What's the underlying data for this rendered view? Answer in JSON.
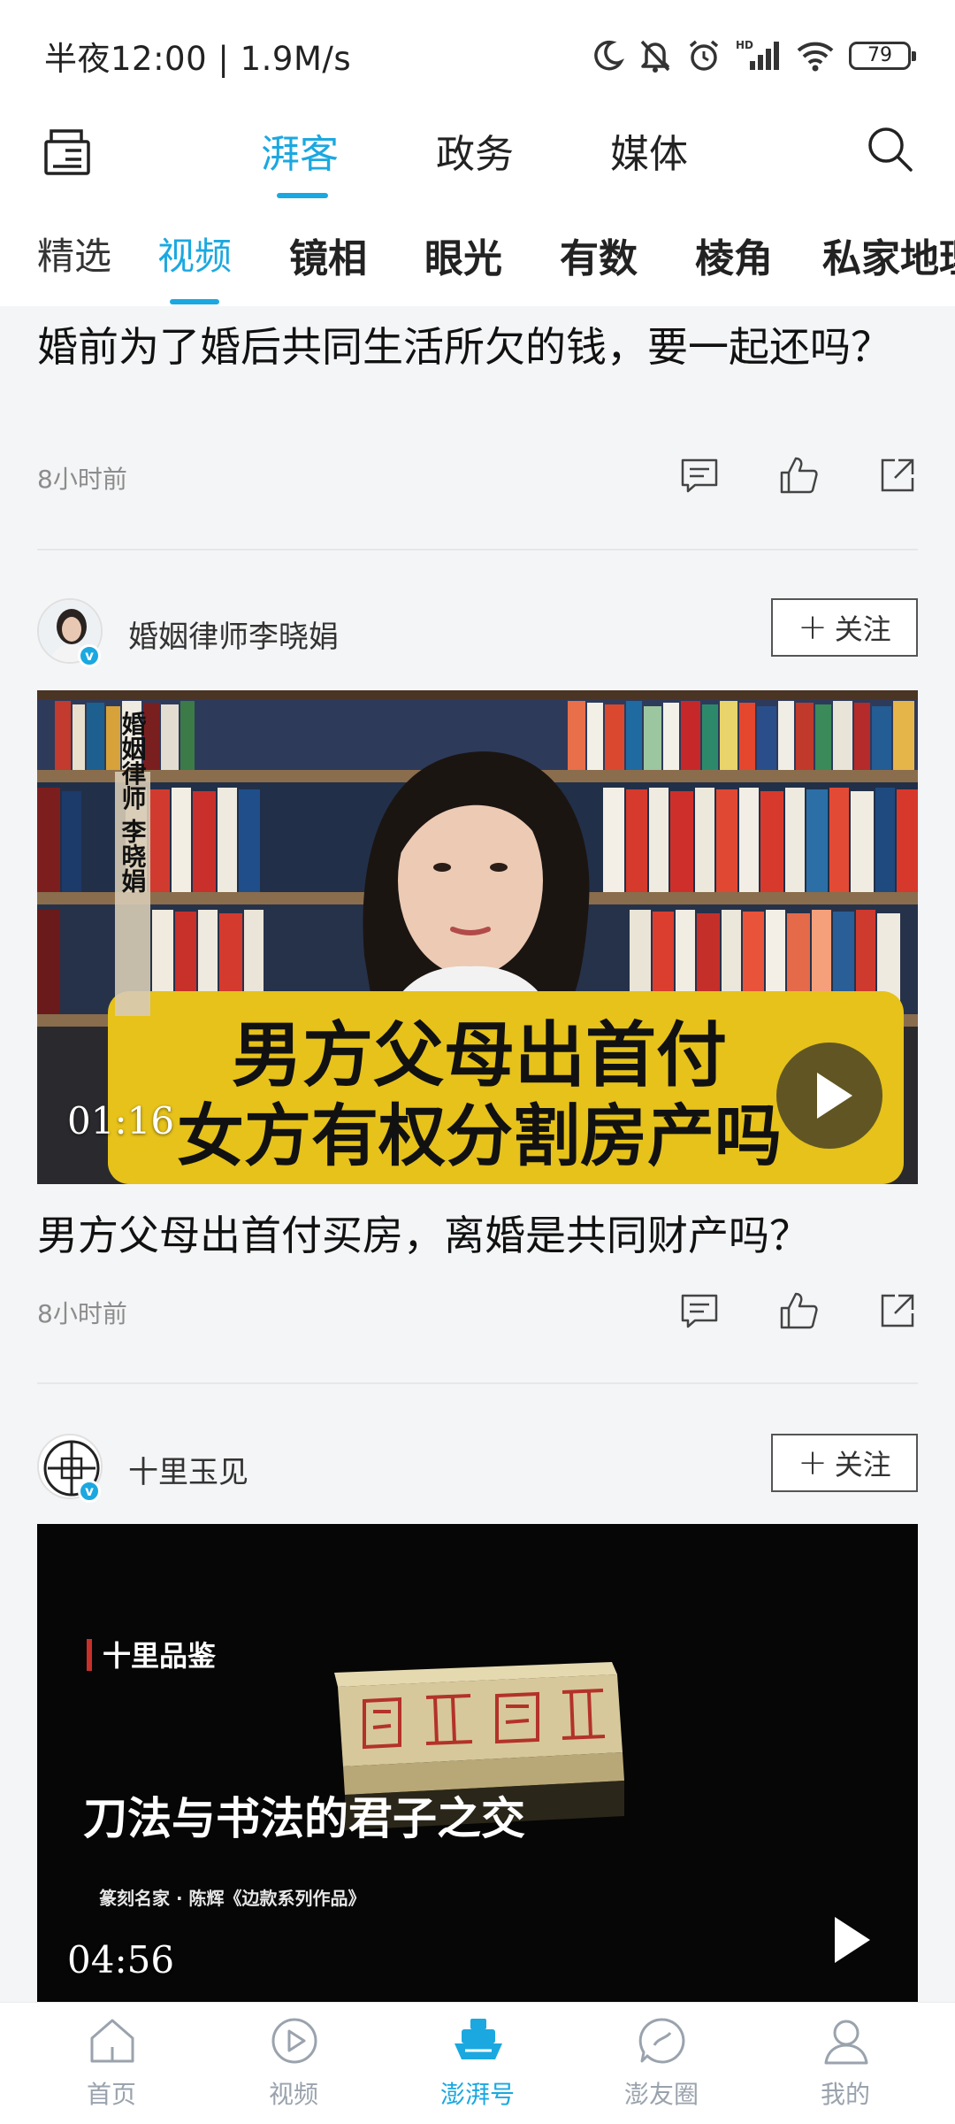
{
  "status_bar": {
    "time": "半夜12:00 | 1.9M/s",
    "battery": "79"
  },
  "top_nav": {
    "tabs": [
      "湃客",
      "政务",
      "媒体"
    ],
    "active_tab": "湃客"
  },
  "sub_tabs": {
    "items": [
      "精选",
      "视频",
      "镜相",
      "眼光",
      "有数",
      "棱角",
      "私家地理"
    ],
    "active": "视频"
  },
  "feed": [
    {
      "title": "婚前为了婚后共同生活所欠的钱，要一起还吗？",
      "time": "8小时前"
    },
    {
      "author": "婚姻律师李晓娟",
      "follow_label": "关注",
      "video_caption_line1": "男方父母出首付",
      "video_caption_line2": "女方有权分割房产吗",
      "video_side_label": "婚姻律师 李晓娟",
      "duration": "01:16",
      "title": "男方父母出首付买房，离婚是共同财产吗？",
      "time": "8小时前"
    },
    {
      "author": "十里玉见",
      "follow_label": "关注",
      "video_brand": "十里品鉴",
      "video_headline": "刀法与书法的君子之交",
      "video_subline": "篆刻名家 · 陈辉《边款系列作品》",
      "duration": "04:56"
    }
  ],
  "bottom_nav": {
    "items": [
      "首页",
      "视频",
      "澎湃号",
      "澎友圈",
      "我的"
    ],
    "active": "澎湃号"
  },
  "colors": {
    "accent": "#1ba8e0",
    "background": "#f4f5f6",
    "caption_yellow": "#e6c21a"
  }
}
